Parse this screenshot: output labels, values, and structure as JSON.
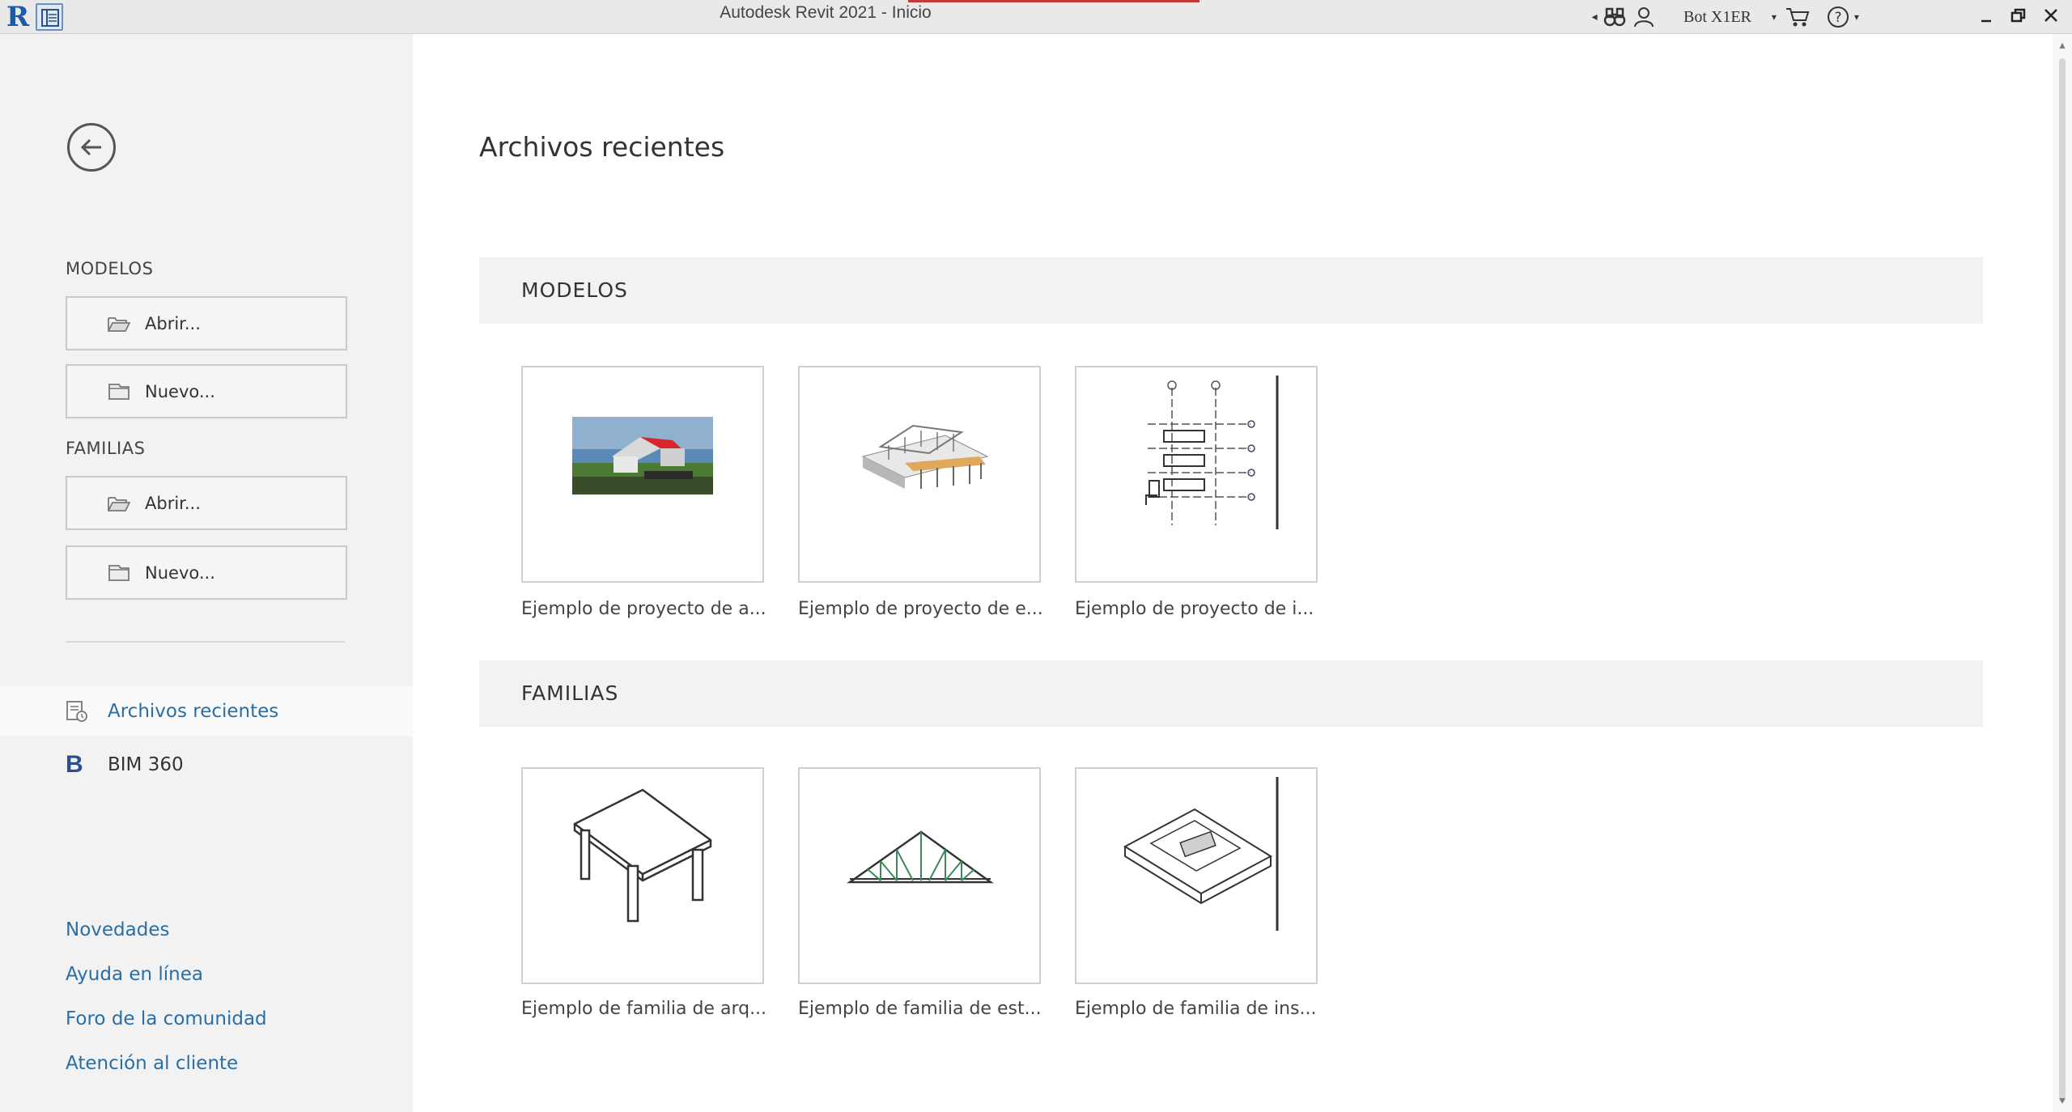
{
  "titlebar": {
    "title": "Autodesk Revit 2021 - Inicio",
    "app_logo": "R",
    "user": "Bot X1ER",
    "icons": [
      "quick-access-icon",
      "binoculars-icon",
      "user-icon",
      "cart-icon",
      "help-icon"
    ],
    "help": "?"
  },
  "sidebar": {
    "models_heading": "MODELOS",
    "models_open": "Abrir...",
    "models_new": "Nuevo...",
    "families_heading": "FAMILIAS",
    "families_open": "Abrir...",
    "families_new": "Nuevo...",
    "nav": {
      "recent": "Archivos recientes",
      "bim_letter": "B",
      "bim": "BIM 360"
    },
    "links": {
      "news": "Novedades",
      "help": "Ayuda en línea",
      "forum": "Foro de la comunidad",
      "support": "Atención al cliente"
    }
  },
  "main": {
    "title": "Archivos recientes",
    "models_section": "MODELOS",
    "families_section": "FAMILIAS",
    "models": [
      {
        "label": "Ejemplo de proyecto de a..."
      },
      {
        "label": "Ejemplo de proyecto de e..."
      },
      {
        "label": "Ejemplo de proyecto de i..."
      }
    ],
    "families": [
      {
        "label": "Ejemplo de familia de arq..."
      },
      {
        "label": "Ejemplo de familia de est..."
      },
      {
        "label": "Ejemplo de familia de ins..."
      }
    ]
  },
  "colors": {
    "accent": "#2a6ea6",
    "sidebar_bg": "#f2f2f2",
    "section_bg": "#f2f2f2"
  }
}
